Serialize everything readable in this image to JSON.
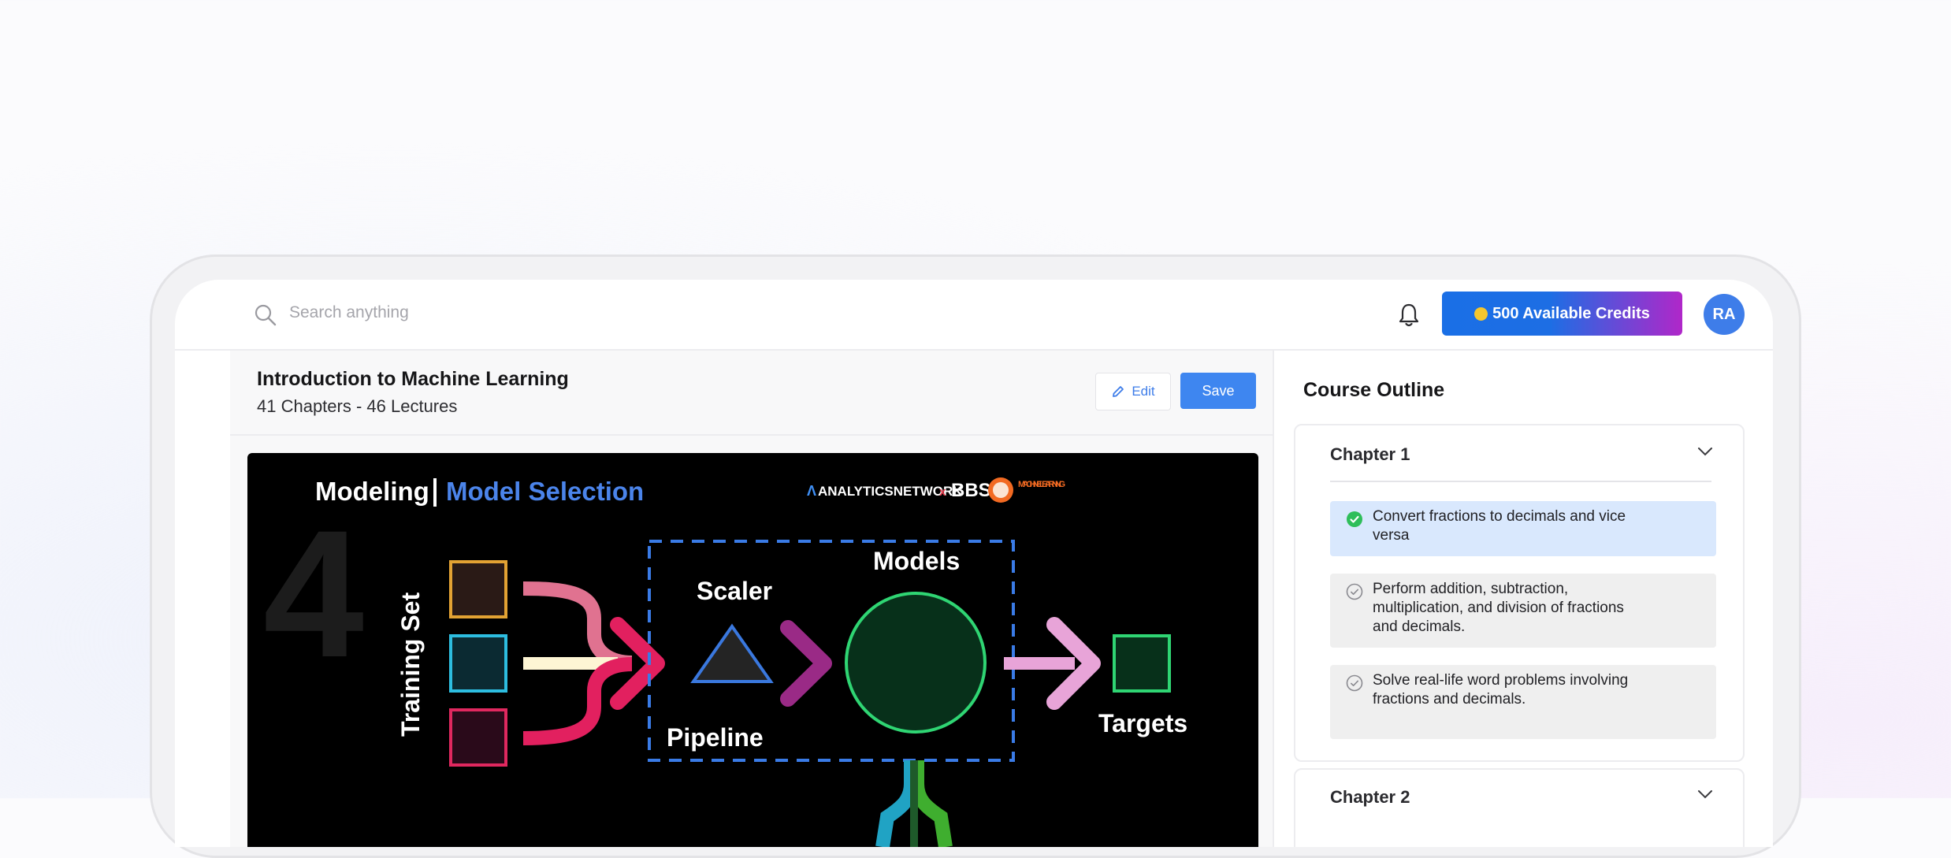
{
  "search": {
    "placeholder": "Search anything"
  },
  "header": {
    "credits_label": "500 Available Credits",
    "avatar_initials": "RA"
  },
  "course": {
    "title": "Introduction to Machine Learning",
    "subtitle": "41 Chapters - 46 Lectures",
    "edit_label": "Edit",
    "save_label": "Save"
  },
  "slide": {
    "chapter_number": "4",
    "heading_left": "Modeling",
    "heading_right": "Model Selection",
    "brand_left": "ANALYTICSNETWORK",
    "brand_x": "x",
    "brand_right": "BBS",
    "brand_badge": "MACHINE LEARNING",
    "label_training_set": "Training Set",
    "label_scaler": "Scaler",
    "label_models": "Models",
    "label_pipeline": "Pipeline",
    "label_targets": "Targets"
  },
  "outline": {
    "title": "Course Outline",
    "chapters": [
      {
        "name": "Chapter 1",
        "items": [
          {
            "text": "Convert fractions to decimals and vice versa",
            "status": "completed"
          },
          {
            "text": "Perform addition, subtraction, multiplication, and division of fractions and decimals.",
            "status": "pending"
          },
          {
            "text": "Solve real-life word problems involving fractions and decimals.",
            "status": "pending"
          }
        ]
      },
      {
        "name": "Chapter 2",
        "items": []
      }
    ]
  },
  "colors": {
    "accent": "#3e86f0",
    "credits_gradient_start": "#1a6fe6",
    "credits_gradient_end": "#b027c9",
    "completed_check": "#2fbe5a",
    "active_item_bg": "#d9e8fd"
  }
}
